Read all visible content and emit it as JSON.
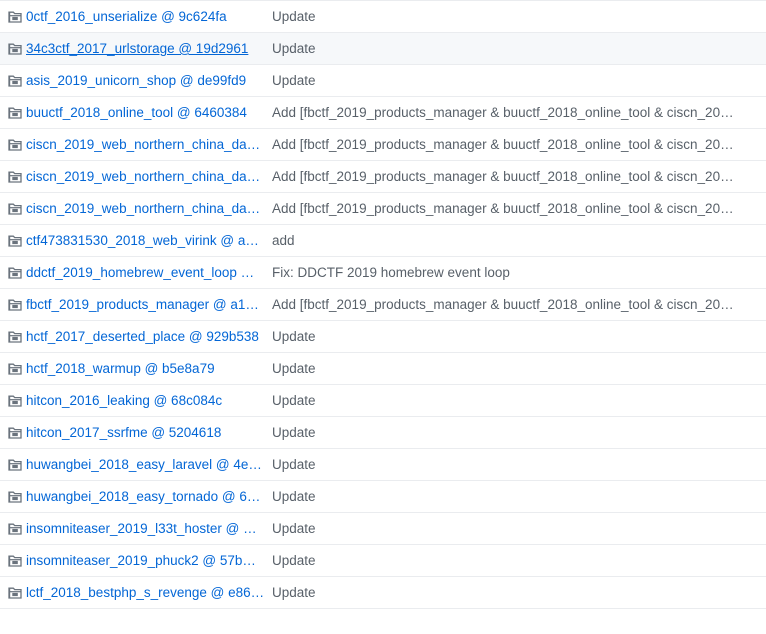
{
  "file_list": {
    "rows": [
      {
        "name": "0ctf_2016_unserialize @ 9c624fa",
        "message": "Update",
        "icon": "folder-submodule-icon"
      },
      {
        "name": "34c3ctf_2017_urlstorage @ 19d2961",
        "message": "Update",
        "icon": "folder-submodule-icon",
        "hovered": true
      },
      {
        "name": "asis_2019_unicorn_shop @ de99fd9",
        "message": "Update",
        "icon": "folder-submodule-icon"
      },
      {
        "name": "buuctf_2018_online_tool @ 6460384",
        "message": "Add [fbctf_2019_products_manager & buuctf_2018_online_tool & ciscn_20…",
        "icon": "folder-submodule-icon"
      },
      {
        "name": "ciscn_2019_web_northern_china_da…",
        "message": "Add [fbctf_2019_products_manager & buuctf_2018_online_tool & ciscn_20…",
        "icon": "folder-submodule-icon"
      },
      {
        "name": "ciscn_2019_web_northern_china_da…",
        "message": "Add [fbctf_2019_products_manager & buuctf_2018_online_tool & ciscn_20…",
        "icon": "folder-submodule-icon"
      },
      {
        "name": "ciscn_2019_web_northern_china_da…",
        "message": "Add [fbctf_2019_products_manager & buuctf_2018_online_tool & ciscn_20…",
        "icon": "folder-submodule-icon"
      },
      {
        "name": "ctf473831530_2018_web_virink @ a…",
        "message": "add",
        "icon": "folder-submodule-icon"
      },
      {
        "name": "ddctf_2019_homebrew_event_loop …",
        "message": "Fix: DDCTF 2019 homebrew event loop",
        "icon": "folder-submodule-icon"
      },
      {
        "name": "fbctf_2019_products_manager @ a1…",
        "message": "Add [fbctf_2019_products_manager & buuctf_2018_online_tool & ciscn_20…",
        "icon": "folder-submodule-icon"
      },
      {
        "name": "hctf_2017_deserted_place @ 929b538",
        "message": "Update",
        "icon": "folder-submodule-icon"
      },
      {
        "name": "hctf_2018_warmup @ b5e8a79",
        "message": "Update",
        "icon": "folder-submodule-icon"
      },
      {
        "name": "hitcon_2016_leaking @ 68c084c",
        "message": "Update",
        "icon": "folder-submodule-icon"
      },
      {
        "name": "hitcon_2017_ssrfme @ 5204618",
        "message": "Update",
        "icon": "folder-submodule-icon"
      },
      {
        "name": "huwangbei_2018_easy_laravel @ 4e…",
        "message": "Update",
        "icon": "folder-submodule-icon"
      },
      {
        "name": "huwangbei_2018_easy_tornado @ 6…",
        "message": "Update",
        "icon": "folder-submodule-icon"
      },
      {
        "name": "insomniteaser_2019_l33t_hoster @ …",
        "message": "Update",
        "icon": "folder-submodule-icon"
      },
      {
        "name": "insomniteaser_2019_phuck2 @ 57b…",
        "message": "Update",
        "icon": "folder-submodule-icon"
      },
      {
        "name": "lctf_2018_bestphp_s_revenge @ e86…",
        "message": "Update",
        "icon": "folder-submodule-icon"
      }
    ]
  },
  "colors": {
    "link": "#0366d6",
    "icon": "#6a737d",
    "message": "#586069",
    "border": "#eaecef",
    "hover_bg": "#f6f8fa"
  }
}
